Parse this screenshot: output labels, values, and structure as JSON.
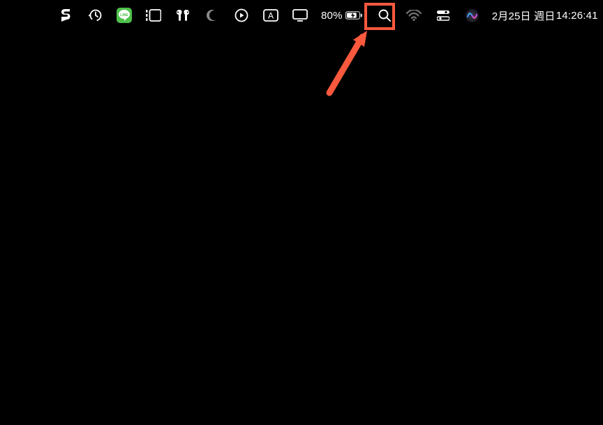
{
  "menubar": {
    "battery_percent": "80%",
    "date": "2月25日 週日",
    "time": "14:26:41",
    "icons": {
      "splice": "splice-icon",
      "timemachine": "timemachine-icon",
      "line": "line-icon",
      "stagemanager": "stagemanager-icon",
      "airpods": "airpods-icon",
      "dnd": "dnd-moon-icon",
      "play": "play-circle-icon",
      "inputmethod": "input-method-icon",
      "display": "display-icon",
      "battery": "battery-icon",
      "spotlight": "spotlight-search-icon",
      "wifi": "wifi-icon",
      "controlcenter": "control-center-icon",
      "siri": "siri-icon"
    }
  },
  "annotation": {
    "highlight_target": "spotlight-search-icon",
    "highlight_color": "#fb593e"
  }
}
